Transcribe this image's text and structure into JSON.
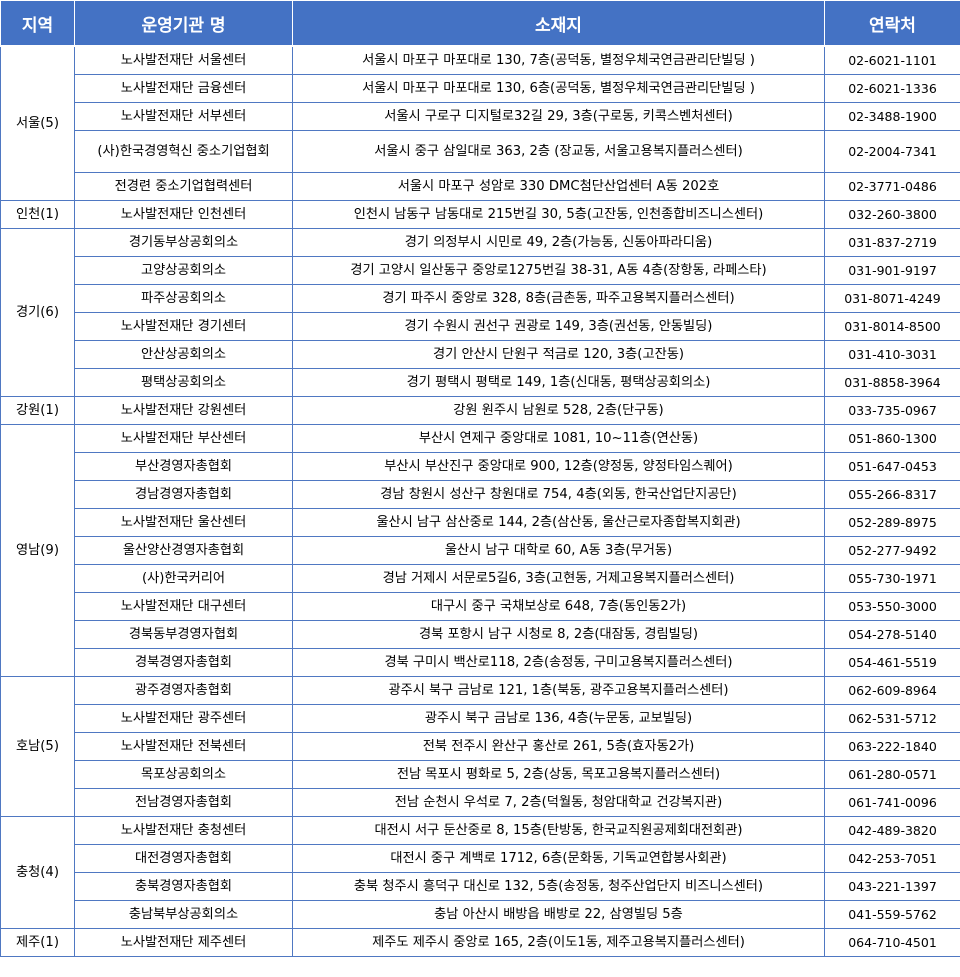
{
  "headers": {
    "region": "지역",
    "org": "운영기관 명",
    "address": "소재지",
    "phone": "연락처"
  },
  "groups": [
    {
      "region": "서울(5)",
      "rows": [
        {
          "org": "노사발전재단 서울센터",
          "address": "서울시 마포구 마포대로 130, 7층(공덕동, 별정우체국연금관리단빌딩 )",
          "phone": "02-6021-1101"
        },
        {
          "org": "노사발전재단 금융센터",
          "address": "서울시 마포구 마포대로 130, 6층(공덕동, 별정우체국연금관리단빌딩 )",
          "phone": "02-6021-1336"
        },
        {
          "org": "노사발전재단 서부센터",
          "address": "서울시 구로구 디지털로32길 29, 3층(구로동, 키콕스벤처센터)",
          "phone": "02-3488-1900"
        },
        {
          "org": "(사)한국경영혁신 중소기업협회",
          "address": "서울시 중구 삼일대로 363, 2층 (장교동, 서울고용복지플러스센터)",
          "phone": "02-2004-7341"
        },
        {
          "org": "전경련 중소기업협력센터",
          "address": "서울시 마포구 성암로 330 DMC첨단산업센터 A동 202호",
          "phone": "02-3771-0486"
        }
      ]
    },
    {
      "region": "인천(1)",
      "rows": [
        {
          "org": "노사발전재단 인천센터",
          "address": "인천시 남동구 남동대로 215번길 30, 5층(고잔동, 인천종합비즈니스센터)",
          "phone": "032-260-3800"
        }
      ]
    },
    {
      "region": "경기(6)",
      "rows": [
        {
          "org": "경기동부상공회의소",
          "address": "경기 의정부시 시민로 49, 2층(가능동, 신동아파라디움)",
          "phone": "031-837-2719"
        },
        {
          "org": "고양상공회의소",
          "address": "경기 고양시 일산동구 중앙로1275번길 38-31, A동 4층(장항동, 라페스타)",
          "phone": "031-901-9197"
        },
        {
          "org": "파주상공회의소",
          "address": "경기 파주시 중앙로 328, 8층(금촌동, 파주고용복지플러스센터)",
          "phone": "031-8071-4249"
        },
        {
          "org": "노사발전재단 경기센터",
          "address": "경기 수원시 권선구 권광로 149, 3층(권선동, 안동빌딩)",
          "phone": "031-8014-8500"
        },
        {
          "org": "안산상공회의소",
          "address": "경기 안산시 단원구 적금로 120, 3층(고잔동)",
          "phone": "031-410-3031"
        },
        {
          "org": "평택상공회의소",
          "address": "경기 평택시 평택로 149, 1층(신대동, 평택상공회의소)",
          "phone": "031-8858-3964"
        }
      ]
    },
    {
      "region": "강원(1)",
      "rows": [
        {
          "org": "노사발전재단 강원센터",
          "address": "강원 원주시 남원로 528, 2층(단구동)",
          "phone": "033-735-0967"
        }
      ]
    },
    {
      "region": "영남(9)",
      "rows": [
        {
          "org": "노사발전재단 부산센터",
          "address": "부산시 연제구 중앙대로 1081, 10~11층(연산동)",
          "phone": "051-860-1300"
        },
        {
          "org": "부산경영자총협회",
          "address": "부산시 부산진구 중앙대로 900, 12층(양정동, 양정타임스퀘어)",
          "phone": "051-647-0453"
        },
        {
          "org": "경남경영자총협회",
          "address": "경남 창원시 성산구 창원대로 754, 4층(외동, 한국산업단지공단)",
          "phone": "055-266-8317"
        },
        {
          "org": "노사발전재단 울산센터",
          "address": "울산시 남구 삼산중로 144, 2층(삼산동, 울산근로자종합복지회관)",
          "phone": "052-289-8975"
        },
        {
          "org": "울산양산경영자총협회",
          "address": "울산시 남구 대학로 60, A동 3층(무거동)",
          "phone": "052-277-9492"
        },
        {
          "org": "(사)한국커리어",
          "address": "경남 거제시 서문로5길6, 3층(고현동, 거제고용복지플러스센터)",
          "phone": "055-730-1971"
        },
        {
          "org": "노사발전재단 대구센터",
          "address": "대구시 중구 국채보상로 648, 7층(동인동2가)",
          "phone": "053-550-3000"
        },
        {
          "org": "경북동부경영자협회",
          "address": "경북 포항시 남구 시청로 8, 2층(대잠동, 경림빌딩)",
          "phone": "054-278-5140"
        },
        {
          "org": "경북경영자총협회",
          "address": "경북 구미시 백산로118, 2층(송정동, 구미고용복지플러스센터)",
          "phone": "054-461-5519"
        }
      ]
    },
    {
      "region": "호남(5)",
      "rows": [
        {
          "org": "광주경영자총협회",
          "address": "광주시 북구 금남로 121, 1층(북동, 광주고용복지플러스센터)",
          "phone": "062-609-8964"
        },
        {
          "org": "노사발전재단 광주센터",
          "address": "광주시 북구 금남로 136, 4층(누문동, 교보빌딩)",
          "phone": "062-531-5712"
        },
        {
          "org": "노사발전재단 전북센터",
          "address": "전북 전주시 완산구 홍산로 261, 5층(효자동2가)",
          "phone": "063-222-1840"
        },
        {
          "org": "목포상공회의소",
          "address": "전남 목포시 평화로 5, 2층(상동, 목포고용복지플러스센터)",
          "phone": "061-280-0571"
        },
        {
          "org": "전남경영자총협회",
          "address": "전남 순천시 우석로 7, 2층(덕월동, 청암대학교 건강복지관)",
          "phone": "061-741-0096"
        }
      ]
    },
    {
      "region": "충청(4)",
      "rows": [
        {
          "org": "노사발전재단 충청센터",
          "address": "대전시 서구 둔산중로 8, 15층(탄방동, 한국교직원공제회대전회관)",
          "phone": "042-489-3820"
        },
        {
          "org": "대전경영자총협회",
          "address": "대전시 중구 계백로 1712, 6층(문화동, 기독교연합봉사회관)",
          "phone": "042-253-7051"
        },
        {
          "org": "충북경영자총협회",
          "address": "충북 청주시 흥덕구 대신로 132, 5층(송정동, 청주산업단지 비즈니스센터)",
          "phone": "043-221-1397"
        },
        {
          "org": "충남북부상공회의소",
          "address": "충남 아산시 배방읍 배방로 22, 삼영빌딩 5층",
          "phone": "041-559-5762"
        }
      ]
    },
    {
      "region": "제주(1)",
      "rows": [
        {
          "org": "노사발전재단 제주센터",
          "address": "제주도 제주시 중앙로 165, 2층(이도1동, 제주고용복지플러스센터)",
          "phone": "064-710-4501"
        }
      ]
    }
  ]
}
